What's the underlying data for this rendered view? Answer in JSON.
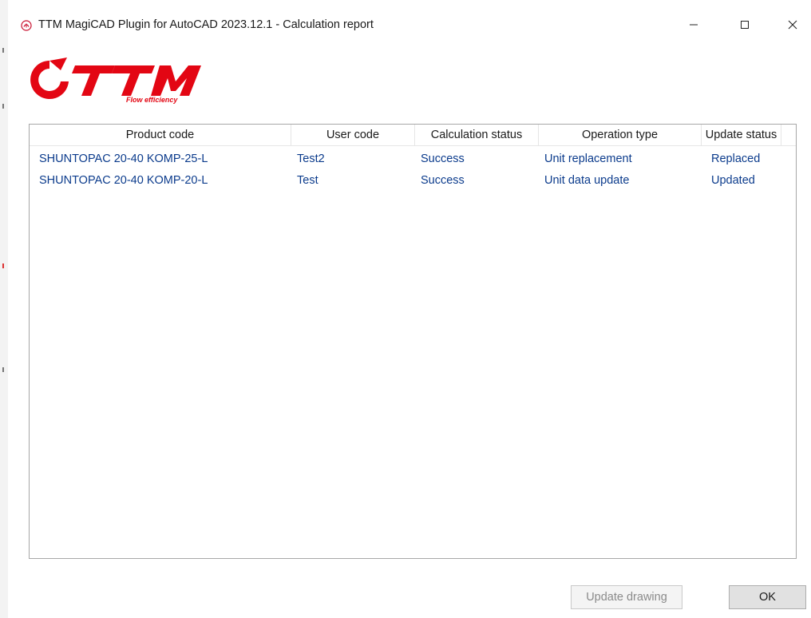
{
  "window": {
    "title": "TTM MagiCAD Plugin for AutoCAD 2023.12.1 - Calculation report",
    "app_icon": "ttm-app-icon",
    "controls": {
      "minimize": "—",
      "maximize": "☐",
      "close": "✕"
    }
  },
  "logo": {
    "brand": "TTM",
    "tagline": "Flow efficiency",
    "color": "#e30613"
  },
  "table": {
    "columns": [
      "Product code",
      "User code",
      "Calculation status",
      "Operation type",
      "Update status"
    ],
    "rows": [
      [
        "SHUNTOPAC 20-40 KOMP-25-L",
        "Test2",
        "Success",
        "Unit replacement",
        "Replaced"
      ],
      [
        "SHUNTOPAC 20-40 KOMP-20-L",
        "Test",
        "Success",
        "Unit data update",
        "Updated"
      ]
    ],
    "text_color": "#0b3b8c"
  },
  "buttons": {
    "update_drawing": "Update drawing",
    "ok": "OK"
  }
}
